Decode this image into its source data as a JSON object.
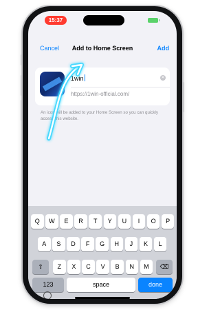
{
  "status": {
    "time": "15:37"
  },
  "nav": {
    "cancel": "Cancel",
    "title": "Add to Home Screen",
    "add": "Add"
  },
  "card": {
    "name_value": "1win",
    "url": "https://1win-official.com/"
  },
  "info_text": "An icon will be added to your Home Screen so you can quickly access this website.",
  "keyboard": {
    "row1": [
      "Q",
      "W",
      "E",
      "R",
      "T",
      "Y",
      "U",
      "I",
      "O",
      "P"
    ],
    "row2": [
      "A",
      "S",
      "D",
      "F",
      "G",
      "H",
      "J",
      "K",
      "L"
    ],
    "row3": [
      "Z",
      "X",
      "C",
      "V",
      "B",
      "N",
      "M"
    ],
    "numbers": "123",
    "space": "space",
    "done": "done"
  },
  "colors": {
    "accent": "#0a84ff",
    "time_pill": "#ff3b30",
    "battery": "#5ad26a",
    "arrow_glow": "#35d6ff"
  }
}
